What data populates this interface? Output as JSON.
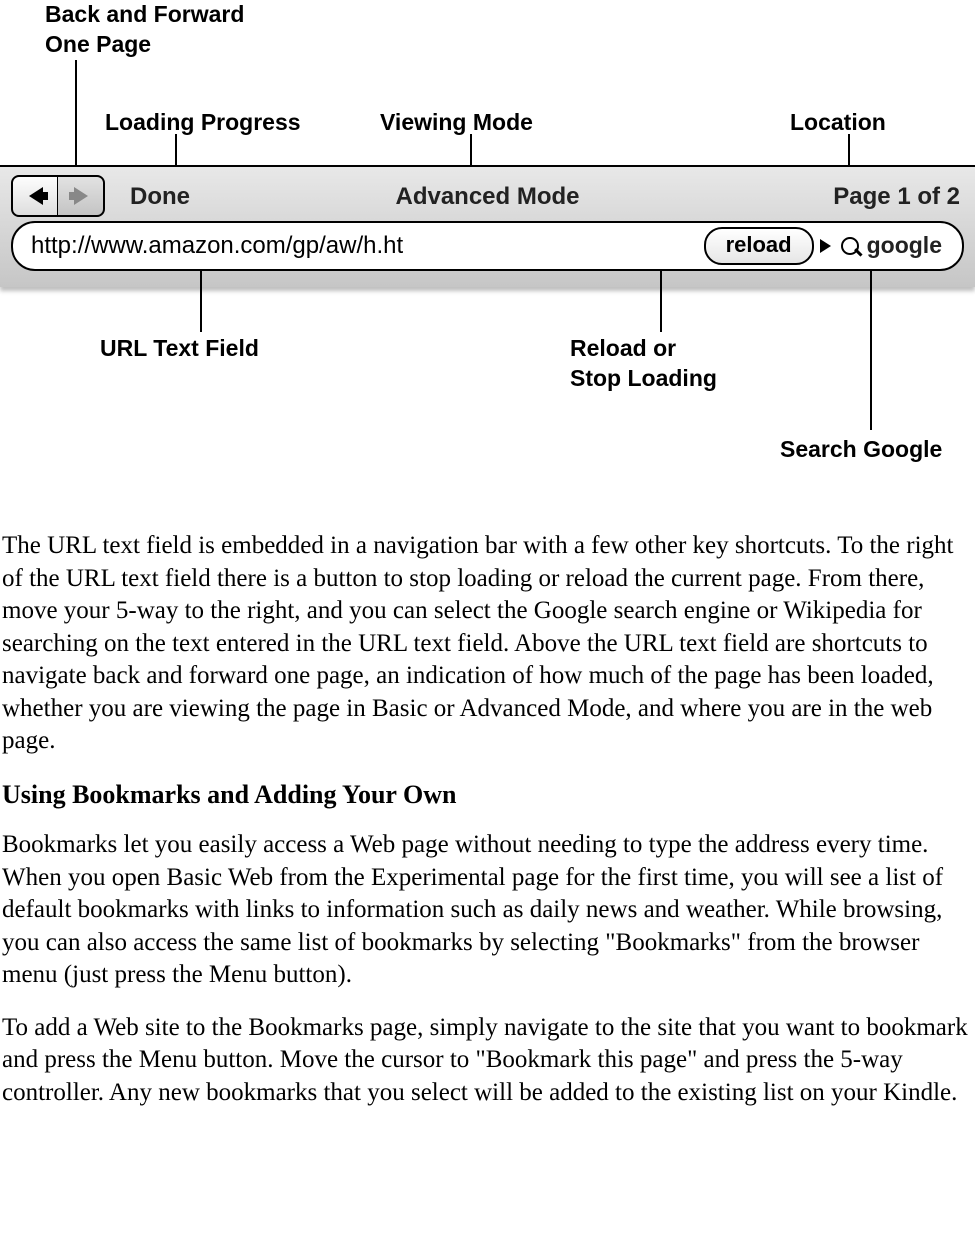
{
  "labels": {
    "back_forward": "Back and Forward\nOne Page",
    "loading_progress": "Loading Progress",
    "viewing_mode": "Viewing Mode",
    "location": "Location",
    "url_field": "URL Text Field",
    "reload_stop": "Reload or\nStop Loading",
    "search_google": "Search Google"
  },
  "toolbar": {
    "done": "Done",
    "mode": "Advanced Mode",
    "location": "Page 1 of 2",
    "url": "http://www.amazon.com/gp/aw/h.ht",
    "reload": "reload",
    "search": "google"
  },
  "body": {
    "p1": "The URL text field is embedded in a navigation bar with a few other key shortcuts. To the right of the URL text field there is a button to stop loading or reload the current page. From there, move your 5-way to the right, and you can select the Google search engine or Wikipedia for searching on the text entered in the URL text field. Above the URL text field are shortcuts to navigate back and forward one page, an indication of how much of the page has been loaded, whether you are viewing the page in Basic or Advanced Mode, and where you are in the web page.",
    "h1": "Using Bookmarks and Adding Your Own",
    "p2": "Bookmarks let you easily access a Web page without needing to type the address every time. When you open Basic Web from the Experimental page for the first time, you will see a list of default bookmarks with links to information such as daily news and weather. While browsing, you can also access the same list of bookmarks by selecting \"Bookmarks\" from the browser menu (just press the Menu button).",
    "p3": "To add a Web site to the Bookmarks page, simply navigate to the site that you want to bookmark and press the Menu button. Move the cursor to \"Bookmark this page\" and press the 5-way controller. Any new bookmarks that you select will be added to the existing list on your Kindle."
  }
}
